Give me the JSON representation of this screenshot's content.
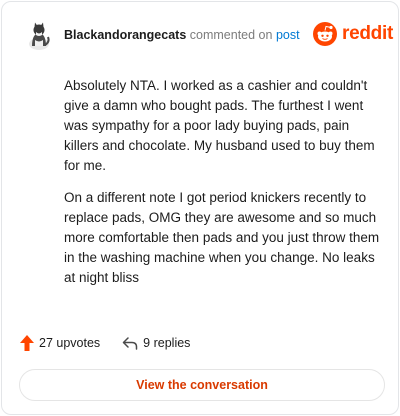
{
  "comment": {
    "username": "Blackandorangecats",
    "action": "commented on",
    "post_link": "post",
    "paragraphs": [
      "Absolutely NTA. I worked as a cashier and couldn't give a damn who bought pads. The furthest I went was sympathy for a poor lady buying pads, pain killers and chocolate. My husband used to buy them for me.",
      "On a different note I got period knickers recently to replace pads, OMG they are awesome and so much more comfortable then pads and you just throw them in the washing machine when you change. No leaks at night bliss"
    ]
  },
  "brand": {
    "wordmark": "reddit",
    "color": "#ff4500"
  },
  "footer": {
    "upvotes": "27 upvotes",
    "replies": "9 replies",
    "upvote_icon": "upvote-arrow-icon",
    "reply_icon": "reply-arrow-icon"
  },
  "button": {
    "label": "View the conversation"
  }
}
